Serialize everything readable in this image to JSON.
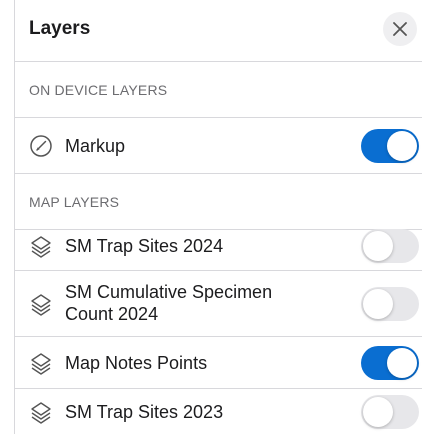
{
  "panel": {
    "title": "Layers",
    "close_icon": "close-icon"
  },
  "sections": {
    "on_device": "ON DEVICE LAYERS",
    "map_layers": "MAP LAYERS"
  },
  "on_device_layers": [
    {
      "label": "Markup",
      "icon": "markup-pen-icon",
      "enabled": true
    }
  ],
  "map_layers": [
    {
      "label": "SM Trap Sites 2024",
      "icon": "layers-icon",
      "enabled": false
    },
    {
      "label": "SM Cumulative Specimen Count 2024",
      "icon": "layers-icon",
      "enabled": false
    },
    {
      "label": "Map Notes Points",
      "icon": "layers-icon",
      "enabled": true
    },
    {
      "label": "SM Trap Sites 2023",
      "icon": "layers-icon",
      "enabled": false
    }
  ],
  "colors": {
    "toggle_on": "#0a6ed1",
    "toggle_off": "#e7e7ea",
    "section_text": "#6c6c70"
  }
}
